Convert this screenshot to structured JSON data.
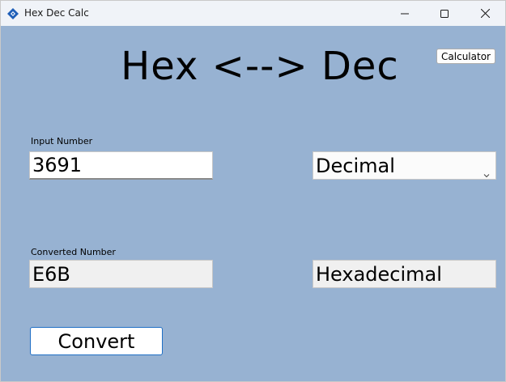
{
  "window": {
    "title": "Hex Dec Calc",
    "icon": "app-logo-icon"
  },
  "window_controls": {
    "minimize_icon": "minimize-icon",
    "maximize_icon": "maximize-icon",
    "close_icon": "close-icon"
  },
  "main": {
    "heading": "Hex <--> Dec",
    "calculator_button": "Calculator",
    "input_label": "Input Number",
    "input_value": "3691",
    "input_type": "Decimal",
    "converted_label": "Converted Number",
    "converted_value": "E6B",
    "output_type": "Hexadecimal",
    "convert_button": "Convert"
  },
  "colors": {
    "background": "#97b2d2",
    "titlebar": "#f0f3f8",
    "convert_border": "#1f6fc5"
  }
}
